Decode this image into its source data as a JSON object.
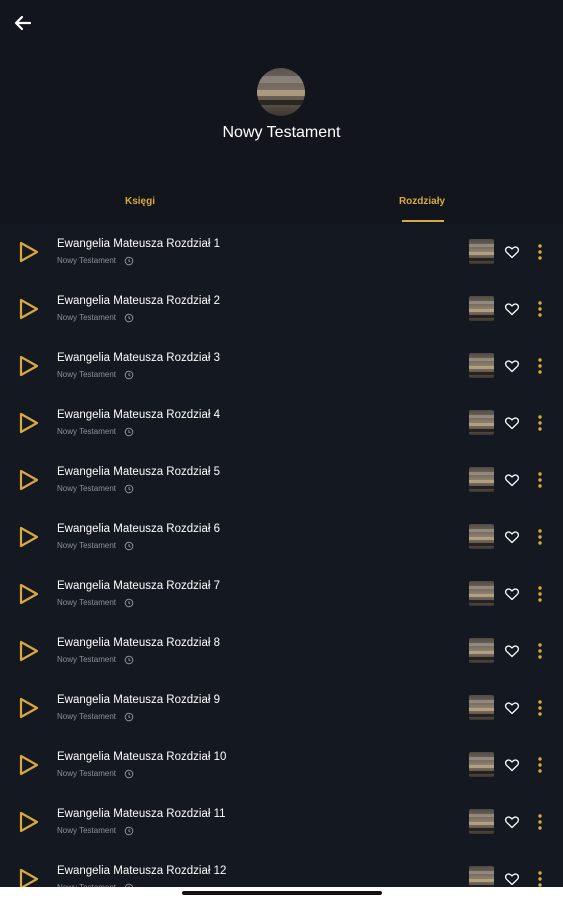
{
  "header": {
    "title": "Nowy Testament",
    "back_icon": "arrow-left-icon",
    "cover_icon": "album-cover-image",
    "colors": {
      "background": "#12151c",
      "accent": "#d9a93e"
    }
  },
  "tabs": [
    {
      "label": "Księgi",
      "active": false
    },
    {
      "label": "Rozdziały",
      "active": true
    }
  ],
  "chapters": [
    {
      "title": "Ewangelia Mateusza Rozdział 1",
      "subtitle": "Nowy Testament"
    },
    {
      "title": "Ewangelia Mateusza Rozdział 2",
      "subtitle": "Nowy Testament"
    },
    {
      "title": "Ewangelia Mateusza Rozdział 3",
      "subtitle": "Nowy Testament"
    },
    {
      "title": "Ewangelia Mateusza Rozdział 4",
      "subtitle": "Nowy Testament"
    },
    {
      "title": "Ewangelia Mateusza Rozdział 5",
      "subtitle": "Nowy Testament"
    },
    {
      "title": "Ewangelia Mateusza Rozdział 6",
      "subtitle": "Nowy Testament"
    },
    {
      "title": "Ewangelia Mateusza Rozdział 7",
      "subtitle": "Nowy Testament"
    },
    {
      "title": "Ewangelia Mateusza Rozdział 8",
      "subtitle": "Nowy Testament"
    },
    {
      "title": "Ewangelia Mateusza Rozdział 9",
      "subtitle": "Nowy Testament"
    },
    {
      "title": "Ewangelia Mateusza Rozdział 10",
      "subtitle": "Nowy Testament"
    },
    {
      "title": "Ewangelia Mateusza Rozdział 11",
      "subtitle": "Nowy Testament"
    },
    {
      "title": "Ewangelia Mateusza Rozdział 12",
      "subtitle": "Nowy Testament"
    }
  ],
  "row_icons": {
    "play": "play-icon",
    "clock": "clock-icon",
    "thumbnail": "chapter-thumbnail",
    "favorite": "heart-icon",
    "more": "more-vertical-icon"
  }
}
